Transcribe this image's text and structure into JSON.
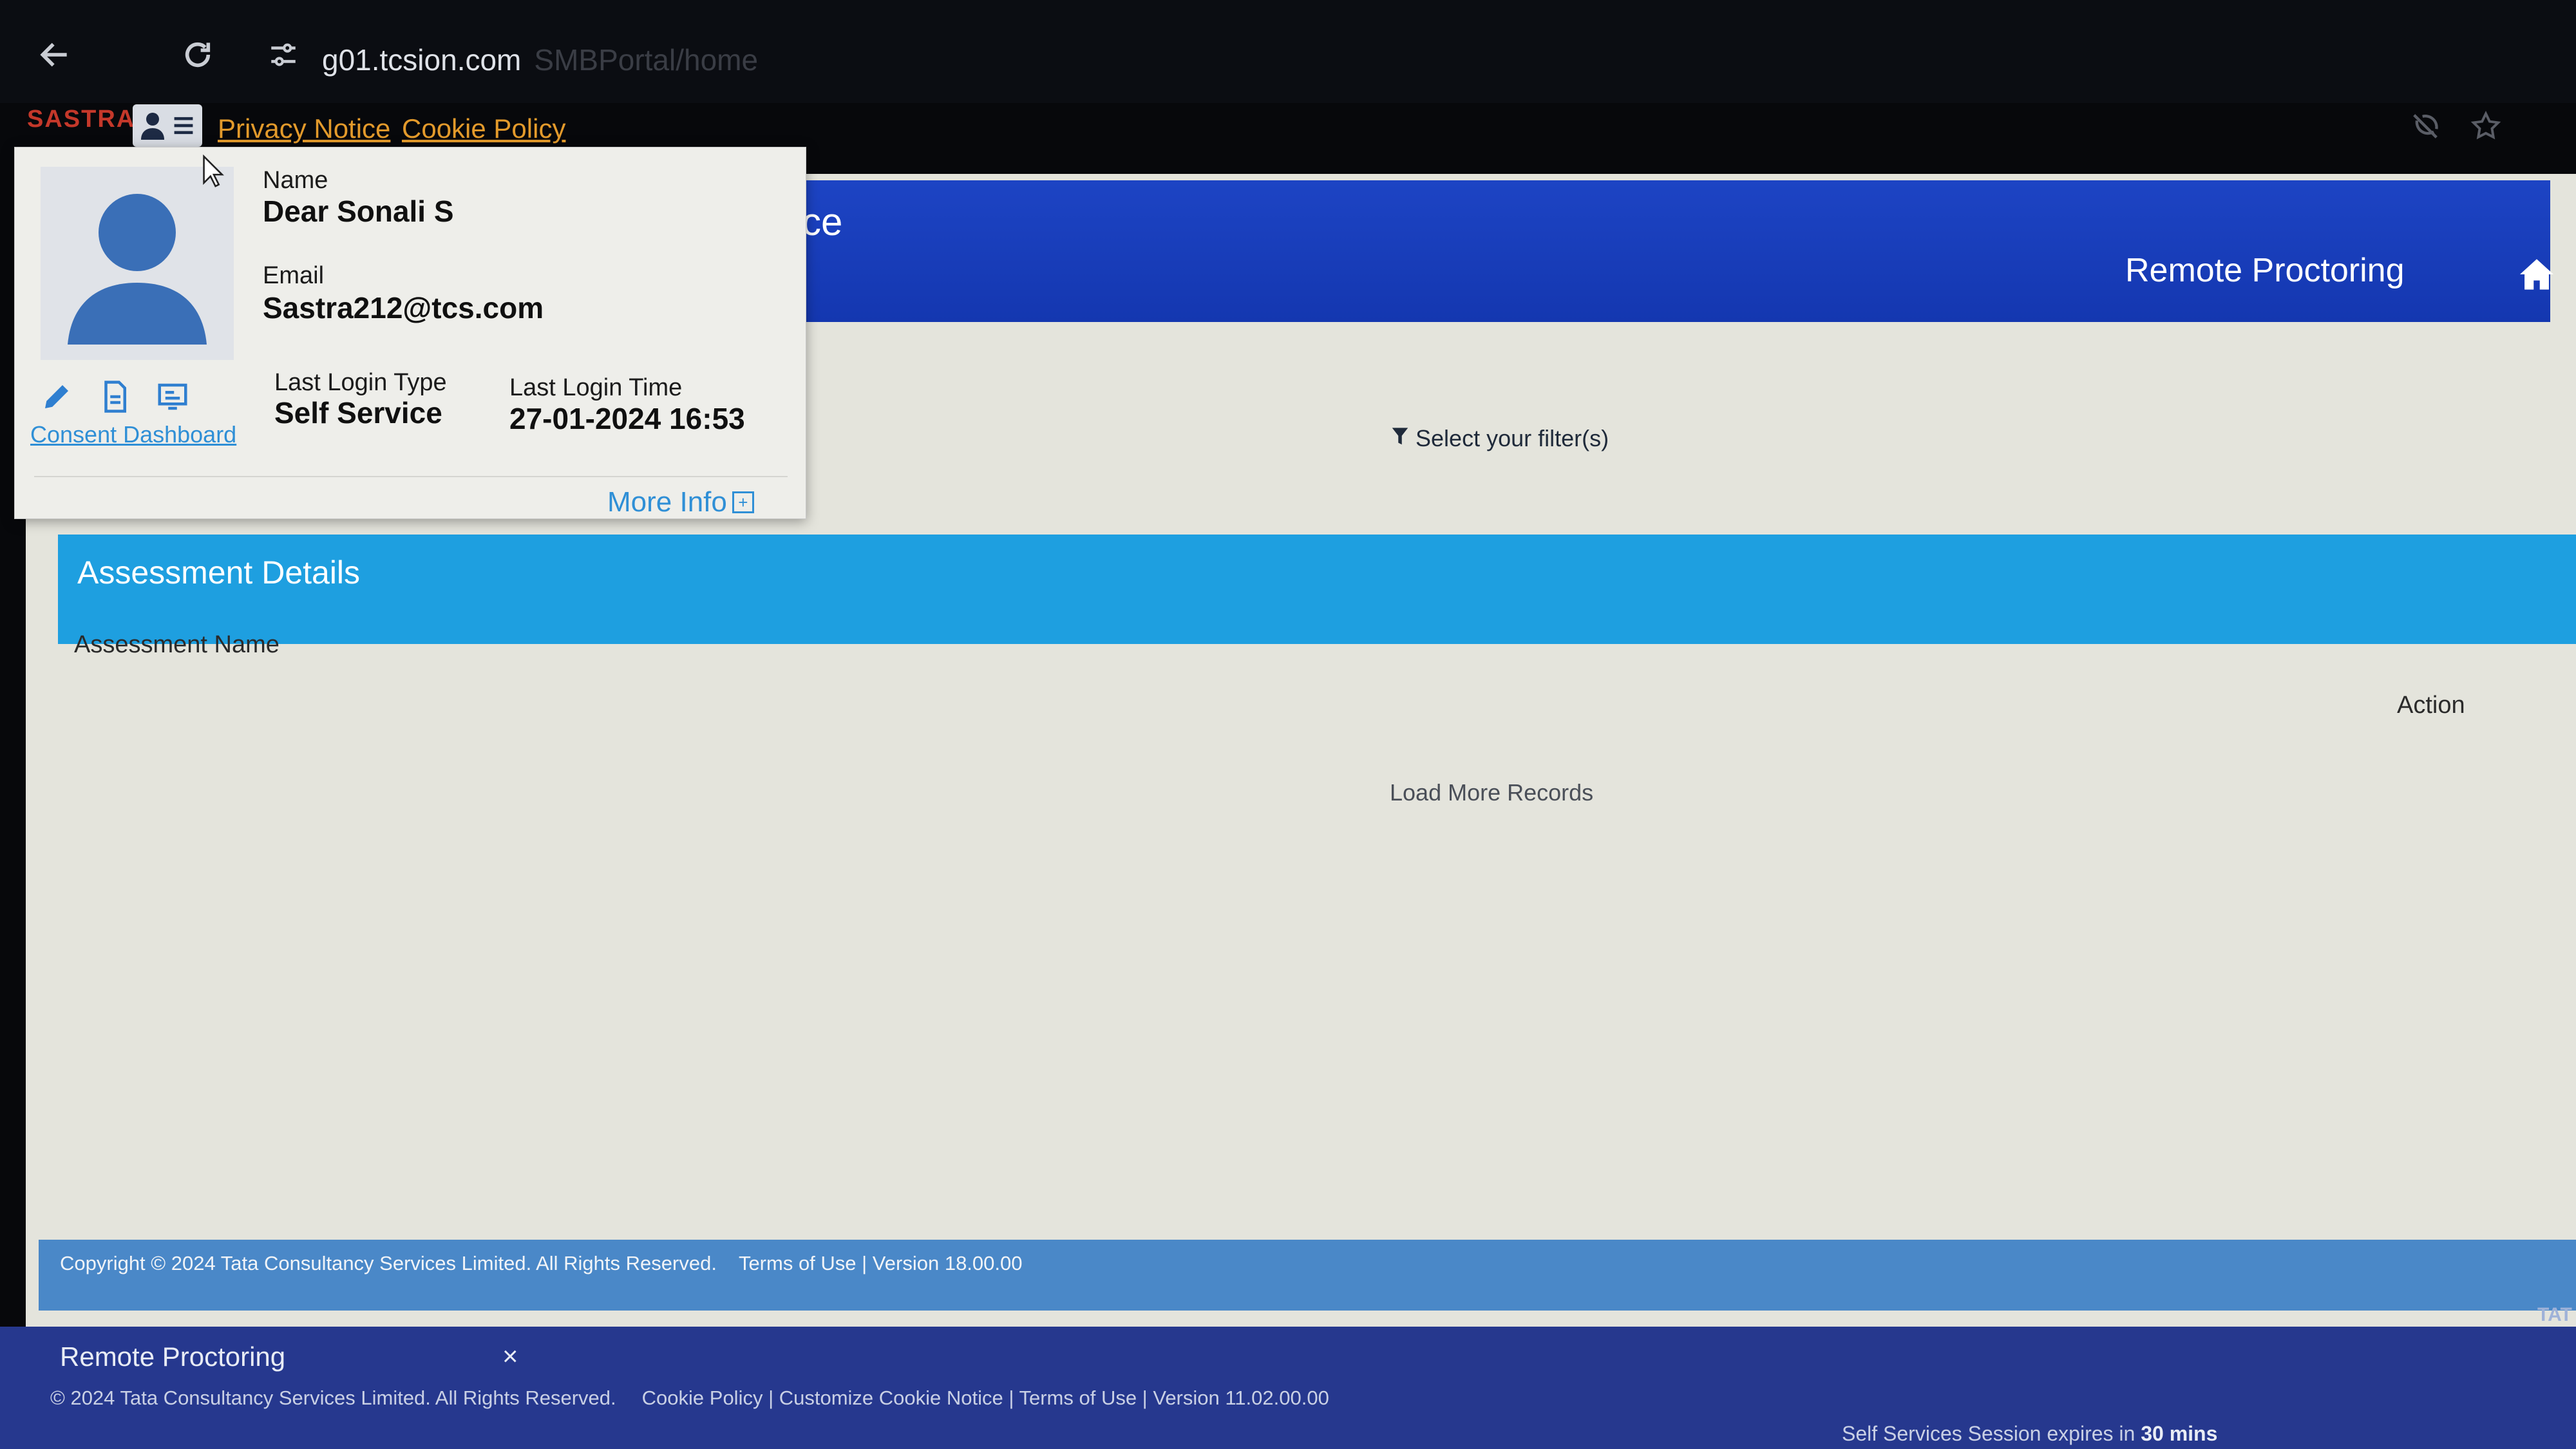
{
  "browser": {
    "url": "g01.tcsion.com",
    "url_path": "SMBPortal/home"
  },
  "topbar": {
    "brand": "SASTRA",
    "privacy_notice": "Privacy Notice",
    "cookie_policy": "Cookie Policy"
  },
  "profile": {
    "name_label": "Name",
    "name_value": "Dear Sonali S",
    "email_label": "Email",
    "email_value": "Sastra212@tcs.com",
    "last_login_type_label": "Last Login Type",
    "last_login_type_value": "Self Service",
    "last_login_time_label": "Last Login Time",
    "last_login_time_value": "27-01-2024 16:53",
    "consent_dashboard": "Consent Dashboard",
    "more_info": "More Info"
  },
  "header": {
    "partial_title": "ce",
    "right_title": "Remote Proctoring"
  },
  "filter": {
    "label": "Select your filter(s)"
  },
  "assessment": {
    "title": "Assessment Details",
    "column_name": "Assessment Name",
    "column_action": "Action",
    "load_more": "Load More Records"
  },
  "footer1": {
    "copyright": "Copyright © 2024 Tata Consultancy Services Limited. All Rights Reserved.",
    "links": "Terms of Use | Version 18.00.00"
  },
  "footer2": {
    "panel_title": "Remote Proctoring",
    "close_symbol": "×",
    "copyright": "© 2024 Tata Consultancy Services Limited. All Rights Reserved.",
    "links": "Cookie Policy | Customize Cookie Notice | Terms of Use | Version 11.02.00.00",
    "session_prefix": "Self Services Session expires in",
    "session_value": "30 mins",
    "tata_mark": "TAT"
  },
  "colors": {
    "header_blue": "#1d44c4",
    "assessment_band": "#1e9fe0",
    "link_orange": "#e39a2b",
    "footer_dark": "#26388e"
  },
  "icons": [
    "back-icon",
    "reload-icon",
    "site-settings-icon",
    "user-menu-icon",
    "edit-icon",
    "document-icon",
    "dashboard-icon",
    "filter-icon",
    "home-icon",
    "close-icon",
    "star-icon",
    "no-eye-icon"
  ]
}
